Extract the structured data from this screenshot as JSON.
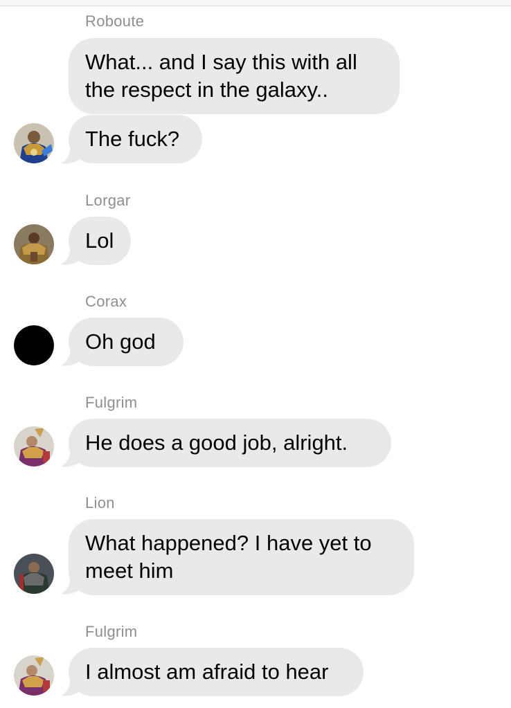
{
  "messages": [
    {
      "sender": "Roboute",
      "bubbles": [
        "What... and I say this with all\nthe respect in the galaxy..",
        "The fuck?"
      ],
      "avatar": "armored-portrait-blue"
    },
    {
      "sender": "Lorgar",
      "bubbles": [
        "Lol"
      ],
      "avatar": "armored-portrait-gold"
    },
    {
      "sender": "Corax",
      "bubbles": [
        "Oh god"
      ],
      "avatar": "black-circle"
    },
    {
      "sender": "Fulgrim",
      "bubbles": [
        "He does a good job, alright."
      ],
      "avatar": "armored-portrait-purple"
    },
    {
      "sender": "Lion",
      "bubbles": [
        "What happened? I have yet to\nmeet him"
      ],
      "avatar": "armored-portrait-dark"
    },
    {
      "sender": "Fulgrim",
      "bubbles": [
        "I almost am afraid to hear"
      ],
      "avatar": "armored-portrait-purple"
    }
  ],
  "colors": {
    "bubble": "#e9e9eb",
    "sender_text": "#8e8e93",
    "message_text": "#000000",
    "background": "#ffffff"
  }
}
